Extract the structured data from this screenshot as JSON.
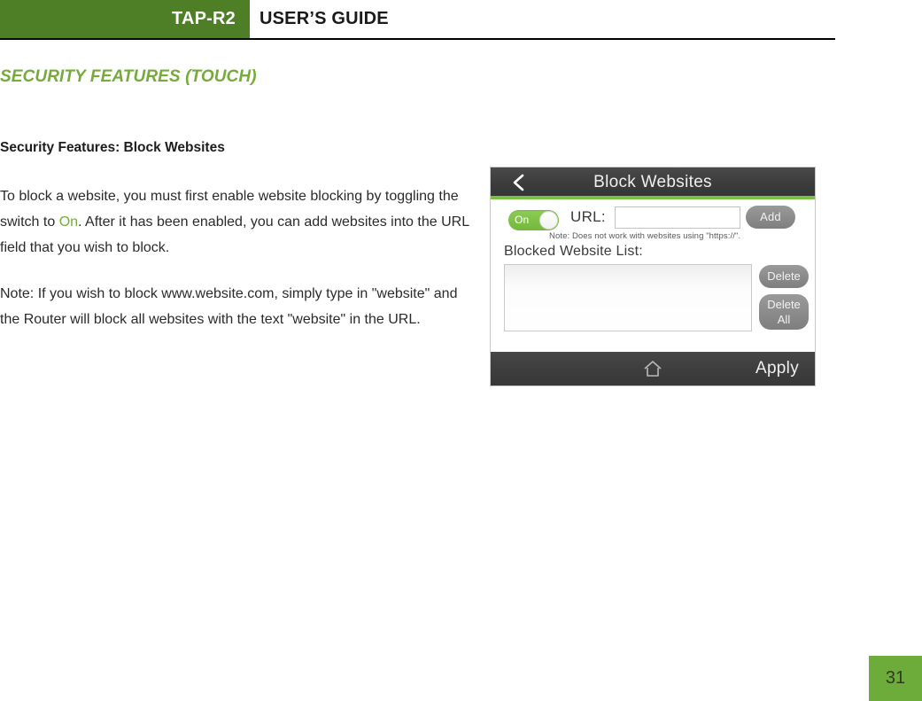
{
  "header": {
    "brand": "TAP-R2",
    "title": "USER’S GUIDE"
  },
  "section": {
    "heading": "SECURITY FEATURES (TOUCH)"
  },
  "content": {
    "subhead": "Security Features: Block Websites",
    "paragraph1_part1": "To block a website, you must first enable website blocking by toggling the switch to ",
    "paragraph1_accent": "On",
    "paragraph1_part2": ".  After it has been enabled, you can add websites into the URL field that you wish to block.",
    "paragraph2": "Note:  If you wish to block www.website.com, simply type in \"website\" and the Router will block all websites with the text \"website\" in the URL."
  },
  "device": {
    "back_icon": "back-chevron-icon",
    "title": "Block Websites",
    "toggle_label": "On",
    "toggle_state": "on",
    "url_label": "URL:",
    "url_value": "",
    "url_placeholder": "",
    "add_label": "Add",
    "note": "Note: Does not work with websites using \"https://\".",
    "list_label": "Blocked Website List:",
    "list_items": [],
    "delete_label": "Delete",
    "delete_all_label": "Delete All",
    "delete_all_line1": "Delete",
    "delete_all_line2": "All",
    "home_icon": "home-icon",
    "apply_label": "Apply"
  },
  "footer": {
    "page_number": "31"
  },
  "colors": {
    "header_green": "#4E7F26",
    "accent_green": "#76AB3A",
    "device_green": "#79C043",
    "toggle_green": "#7DC242",
    "page_number_green": "#6DAB3A",
    "device_dark": "#3C3C3C",
    "button_gray": "#8A8A8A"
  }
}
